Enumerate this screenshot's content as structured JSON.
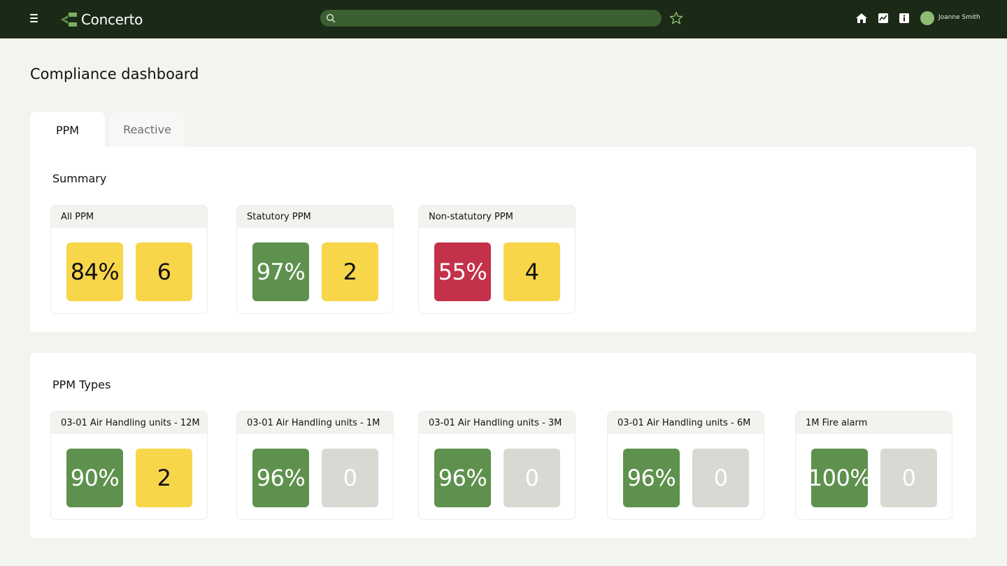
{
  "app": {
    "name": "Concerto",
    "user_name": "Joanne Smith",
    "search_placeholder": "",
    "brand_color": "#1a2a16",
    "accent_color": "#5f914e"
  },
  "icons": {
    "menu": "hamburger-menu-icon",
    "search": "search-icon",
    "favorite": "star-icon",
    "home": "home-icon",
    "reports": "chart-icon",
    "info": "info-icon"
  },
  "page": {
    "title": "Compliance dashboard"
  },
  "tabs": [
    {
      "label": "PPM",
      "active": true
    },
    {
      "label": "Reactive",
      "active": false
    }
  ],
  "summary": {
    "title": "Summary",
    "cards": [
      {
        "title": "All PPM",
        "percent": "84%",
        "percent_status": "yellow",
        "count": "6",
        "count_status": "yellow"
      },
      {
        "title": "Statutory PPM",
        "percent": "97%",
        "percent_status": "green",
        "count": "2",
        "count_status": "yellow"
      },
      {
        "title": "Non-statutory PPM",
        "percent": "55%",
        "percent_status": "red",
        "count": "4",
        "count_status": "yellow"
      }
    ]
  },
  "types": {
    "title": "PPM Types",
    "cards": [
      {
        "title": "03-01 Air Handling units - 12M",
        "percent": "90%",
        "percent_status": "green",
        "count": "2",
        "count_status": "yellow"
      },
      {
        "title": "03-01 Air Handling units - 1M",
        "percent": "96%",
        "percent_status": "green",
        "count": "0",
        "count_status": "grey"
      },
      {
        "title": "03-01 Air Handling units - 3M",
        "percent": "96%",
        "percent_status": "green",
        "count": "0",
        "count_status": "grey"
      },
      {
        "title": "03-01 Air Handling units - 6M",
        "percent": "96%",
        "percent_status": "green",
        "count": "0",
        "count_status": "grey"
      },
      {
        "title": "1M Fire alarm",
        "percent": "100%",
        "percent_status": "green",
        "count": "0",
        "count_status": "grey"
      }
    ]
  },
  "status_colors": {
    "yellow": "#f8d64a",
    "green": "#5f914e",
    "red": "#c4314a",
    "grey": "#d8d9d3"
  }
}
